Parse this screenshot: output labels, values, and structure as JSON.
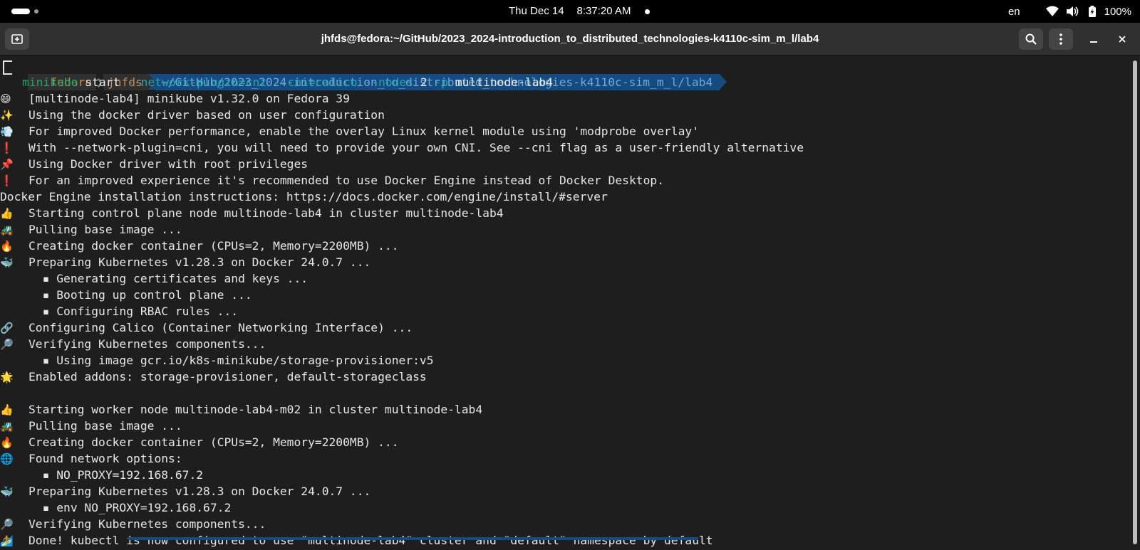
{
  "system": {
    "date": "Thu Dec 14",
    "time": "8:37:20 AM",
    "lang": "en",
    "battery": "100%",
    "icons": [
      "wifi-icon",
      "volume-icon",
      "battery-icon"
    ]
  },
  "window": {
    "title": "jhfds@fedora:~/GitHub/2023_2024-introduction_to_distributed_technologies-k4110c-sim_m_l/lab4"
  },
  "prompt": {
    "host": "fedora",
    "user": "jhfds",
    "path": "~/GitHub/2023_2024-introduction_to_distributed_technologies-k4110c-sim_m_l/lab4",
    "command": {
      "exe": "minikube",
      "sub": "start",
      "flag1": "--network-plugin=cni",
      "flag2": "--cni=calico",
      "flag3": "--nodes",
      "nodes_value": "2",
      "flag4": "-p",
      "profile": "multinode-lab4"
    }
  },
  "output": [
    {
      "emoji": "😄",
      "text": "[multinode-lab4] minikube v1.32.0 on Fedora 39"
    },
    {
      "emoji": "✨",
      "text": "Using the docker driver based on user configuration"
    },
    {
      "emoji": "💨",
      "text": "For improved Docker performance, enable the overlay Linux kernel module using 'modprobe overlay'"
    },
    {
      "emoji": "❗",
      "text": "With --network-plugin=cni, you will need to provide your own CNI. See --cni flag as a user-friendly alternative"
    },
    {
      "emoji": "📌",
      "text": "Using Docker driver with root privileges"
    },
    {
      "emoji": "❗",
      "text": "For an improved experience it's recommended to use Docker Engine instead of Docker Desktop."
    },
    {
      "emoji": "",
      "text": "Docker Engine installation instructions: https://docs.docker.com/engine/install/#server",
      "flush": true
    },
    {
      "emoji": "👍",
      "text": "Starting control plane node multinode-lab4 in cluster multinode-lab4"
    },
    {
      "emoji": "🚜",
      "text": "Pulling base image ..."
    },
    {
      "emoji": "🔥",
      "text": "Creating docker container (CPUs=2, Memory=2200MB) ..."
    },
    {
      "emoji": "🐳",
      "text": "Preparing Kubernetes v1.28.3 on Docker 24.0.7 ..."
    },
    {
      "emoji": "",
      "text": "  ▪ Generating certificates and keys ..."
    },
    {
      "emoji": "",
      "text": "  ▪ Booting up control plane ..."
    },
    {
      "emoji": "",
      "text": "  ▪ Configuring RBAC rules ..."
    },
    {
      "emoji": "🔗",
      "text": "Configuring Calico (Container Networking Interface) ..."
    },
    {
      "emoji": "🔎",
      "text": "Verifying Kubernetes components..."
    },
    {
      "emoji": "",
      "text": "  ▪ Using image gcr.io/k8s-minikube/storage-provisioner:v5"
    },
    {
      "emoji": "🌟",
      "text": "Enabled addons: storage-provisioner, default-storageclass"
    },
    {
      "emoji": "",
      "text": ""
    },
    {
      "emoji": "👍",
      "text": "Starting worker node multinode-lab4-m02 in cluster multinode-lab4"
    },
    {
      "emoji": "🚜",
      "text": "Pulling base image ..."
    },
    {
      "emoji": "🔥",
      "text": "Creating docker container (CPUs=2, Memory=2200MB) ..."
    },
    {
      "emoji": "🌐",
      "text": "Found network options:"
    },
    {
      "emoji": "",
      "text": "  ▪ NO_PROXY=192.168.67.2"
    },
    {
      "emoji": "🐳",
      "text": "Preparing Kubernetes v1.28.3 on Docker 24.0.7 ..."
    },
    {
      "emoji": "",
      "text": "  ▪ env NO_PROXY=192.168.67.2"
    },
    {
      "emoji": "🔎",
      "text": "Verifying Kubernetes components..."
    },
    {
      "emoji": "🏄",
      "text": "Done! kubectl is now configured to use \"multinode-lab4\" cluster and \"default\" namespace by default"
    }
  ]
}
